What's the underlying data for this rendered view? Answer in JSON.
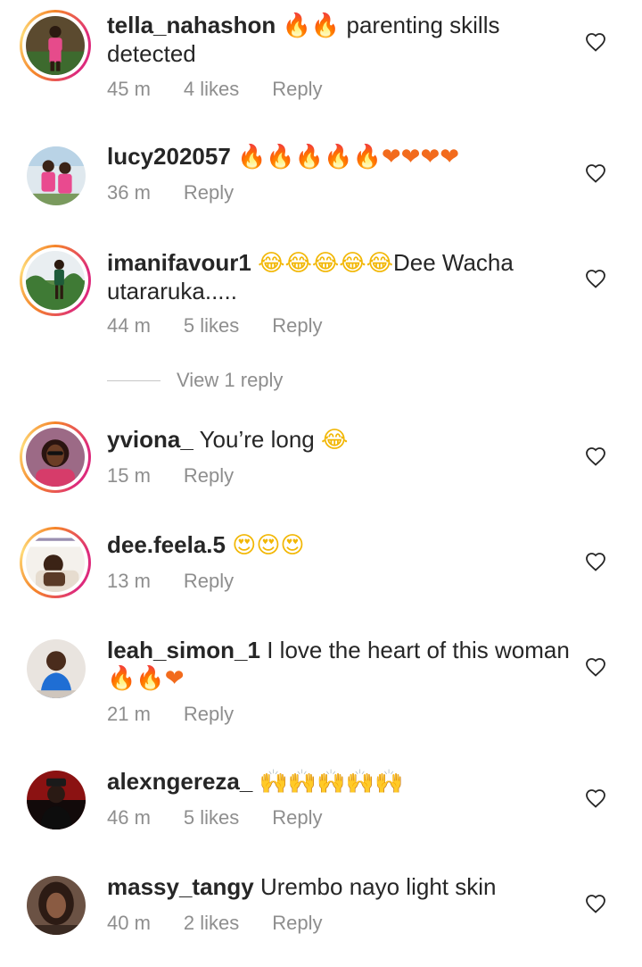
{
  "comments": [
    {
      "username": "tella_nahashon",
      "emoji": "🔥🔥",
      "text": "parenting skills detected",
      "time": "45 m",
      "likes": "4 likes",
      "reply": "Reply"
    },
    {
      "username": "lucy202057",
      "emoji": "🔥🔥🔥🔥🔥❤❤❤❤",
      "text": "",
      "time": "36 m",
      "likes": "",
      "reply": "Reply"
    },
    {
      "username": "imanifavour1",
      "emoji": "😂😂😂😂😂",
      "text": "Dee Wacha utararuka.....",
      "time": "44 m",
      "likes": "5 likes",
      "reply": "Reply",
      "view_replies": "View 1 reply"
    },
    {
      "username": "yviona_",
      "emoji": "😂",
      "text": "You’re long",
      "time": "15 m",
      "likes": "",
      "reply": "Reply"
    },
    {
      "username": "dee.feela.5",
      "emoji": "😍😍😍",
      "text": "",
      "time": "13 m",
      "likes": "",
      "reply": "Reply"
    },
    {
      "username": "leah_simon_1",
      "emoji": "🔥🔥❤",
      "text": "I love the heart of this woman",
      "time": "21 m",
      "likes": "",
      "reply": "Reply"
    },
    {
      "username": "alexngereza_",
      "emoji": "🙌🙌🙌🙌🙌",
      "text": "",
      "time": "46 m",
      "likes": "5 likes",
      "reply": "Reply"
    },
    {
      "username": "massy_tangy",
      "emoji": "",
      "text": "Urembo nayo light skin",
      "time": "40 m",
      "likes": "2 likes",
      "reply": "Reply"
    }
  ],
  "colors": {
    "text": "#262626",
    "meta": "#8e8e8e",
    "ring_start": "#f58529",
    "ring_end": "#dd2a7b"
  }
}
